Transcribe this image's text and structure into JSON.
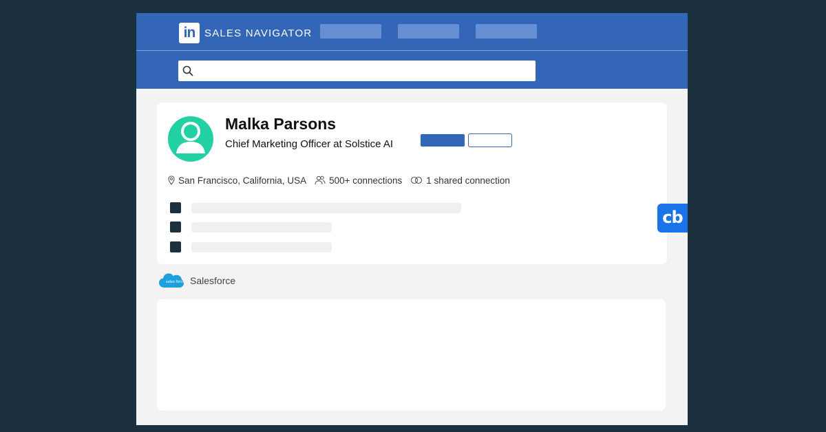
{
  "header": {
    "logo_text": "in",
    "brand": "SALES NAVIGATOR",
    "nav_pills": [
      "",
      "",
      ""
    ]
  },
  "search": {
    "value": "",
    "placeholder": "",
    "icon": "search-icon"
  },
  "profile": {
    "name": "Malka Parsons",
    "title": "Chief Marketing Officer at Solstice AI",
    "avatar_icon": "person-avatar-icon",
    "location": "San Francisco, California, USA",
    "connections": "500+ connections",
    "shared_connections": "1 shared connection",
    "primary_action_label": "",
    "secondary_action_label": ""
  },
  "integration": {
    "logo_icon": "salesforce-cloud-icon",
    "label": "Salesforce"
  },
  "extension_badge": {
    "label": "cb"
  },
  "colors": {
    "background": "#1c3140",
    "header_blue": "#3466b8",
    "avatar_green": "#22d1a3",
    "salesforce_blue": "#1ea0dc",
    "badge_blue": "#1a73e8"
  }
}
